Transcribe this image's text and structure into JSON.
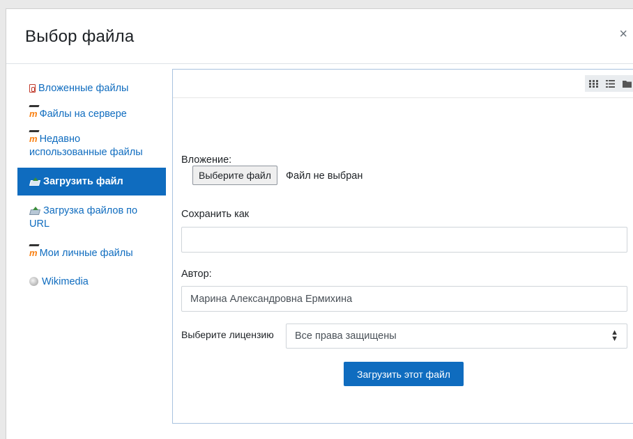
{
  "dialog": {
    "title": "Выбор файла",
    "close_glyph": "×"
  },
  "sidebar": {
    "items": [
      {
        "label": "Вложенные файлы",
        "icon": "attachment-icon"
      },
      {
        "label": "Файлы на сервере",
        "icon": "moodle-icon"
      },
      {
        "label": "Недавно использованные файлы",
        "icon": "moodle-icon"
      },
      {
        "label": "Загрузить файл",
        "icon": "upload-icon",
        "active": true
      },
      {
        "label": "Загрузка файлов по URL",
        "icon": "upload-icon"
      },
      {
        "label": "Мои личные файлы",
        "icon": "moodle-icon"
      },
      {
        "label": "Wikimedia",
        "icon": "globe-icon"
      }
    ]
  },
  "toolbar": {
    "views": [
      "grid-view-icon",
      "list-view-icon",
      "folder-view-icon"
    ]
  },
  "form": {
    "attachment_label": "Вложение:",
    "choose_file_button": "Выберите файл",
    "no_file_text": "Файл не выбран",
    "save_as_label": "Сохранить как",
    "save_as_value": "",
    "author_label": "Автор:",
    "author_value": "Марина Александровна Ермихина",
    "license_label": "Выберите лицензию",
    "license_value": "Все права защищены",
    "submit_button": "Загрузить этот файл"
  },
  "colors": {
    "accent": "#0f6cbf",
    "panel_border": "#a8c2df"
  }
}
